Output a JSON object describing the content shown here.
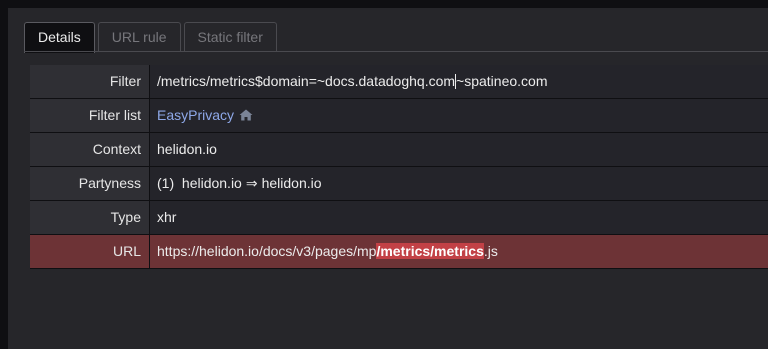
{
  "tabs": [
    {
      "label": "Details",
      "active": true
    },
    {
      "label": "URL rule",
      "active": false
    },
    {
      "label": "Static filter",
      "active": false
    }
  ],
  "rows": {
    "filter": {
      "label": "Filter",
      "value_before": "/metrics/metrics$domain=~docs.datadoghq.com",
      "value_after": "~spatineo.com"
    },
    "filter_list": {
      "label": "Filter list",
      "value": "EasyPrivacy",
      "icon": "home-icon"
    },
    "context": {
      "label": "Context",
      "value": "helidon.io"
    },
    "partyness": {
      "label": "Partyness",
      "count": "(1)",
      "from": "helidon.io",
      "arrow": "⇒",
      "to": "helidon.io"
    },
    "type": {
      "label": "Type",
      "value": "xhr"
    },
    "url": {
      "label": "URL",
      "prefix": "https://helidon.io/docs/v3/pages/mp",
      "highlight": "/metrics/metrics",
      "suffix": ".js"
    }
  },
  "colors": {
    "url_row_bg": "#6d3336",
    "highlight_bg": "#c24146",
    "link": "#8ea8e8"
  }
}
